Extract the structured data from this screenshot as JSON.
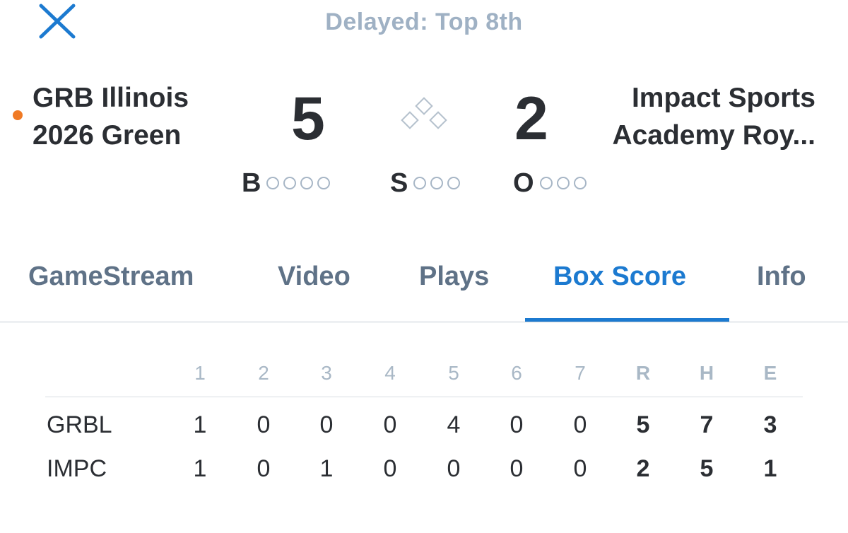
{
  "status": "Delayed:  Top 8th",
  "teams": {
    "away": {
      "name_line1": "GRB Illinois",
      "name_line2": "2026 Green",
      "score": "5",
      "batting_indicator_color": "#f07a24"
    },
    "home": {
      "name_line1": "Impact Sports",
      "name_line2": "Academy Roy...",
      "score": "2"
    }
  },
  "count": {
    "balls": {
      "label": "B",
      "filled": 0,
      "total": 4
    },
    "strikes": {
      "label": "S",
      "filled": 0,
      "total": 3
    },
    "outs": {
      "label": "O",
      "filled": 0,
      "total": 3
    }
  },
  "bases_occupied": {
    "first": false,
    "second": false,
    "third": false
  },
  "tabs": [
    {
      "label": "GameStream",
      "active": false
    },
    {
      "label": "Video",
      "active": false
    },
    {
      "label": "Plays",
      "active": false
    },
    {
      "label": "Box Score",
      "active": true
    },
    {
      "label": "Info",
      "active": false
    }
  ],
  "box_score": {
    "headers": [
      "1",
      "2",
      "3",
      "4",
      "5",
      "6",
      "7",
      "R",
      "H",
      "E"
    ],
    "rows": [
      {
        "team": "GRBL",
        "innings": [
          "1",
          "0",
          "0",
          "0",
          "4",
          "0",
          "0"
        ],
        "r": "5",
        "h": "7",
        "e": "3"
      },
      {
        "team": "IMPC",
        "innings": [
          "1",
          "0",
          "1",
          "0",
          "0",
          "0",
          "0"
        ],
        "r": "2",
        "h": "5",
        "e": "1"
      }
    ]
  },
  "colors": {
    "accent": "#1c7ad0",
    "status": "#9fb1c4",
    "tab_inactive": "#5f7287",
    "text": "#2b2e33"
  }
}
